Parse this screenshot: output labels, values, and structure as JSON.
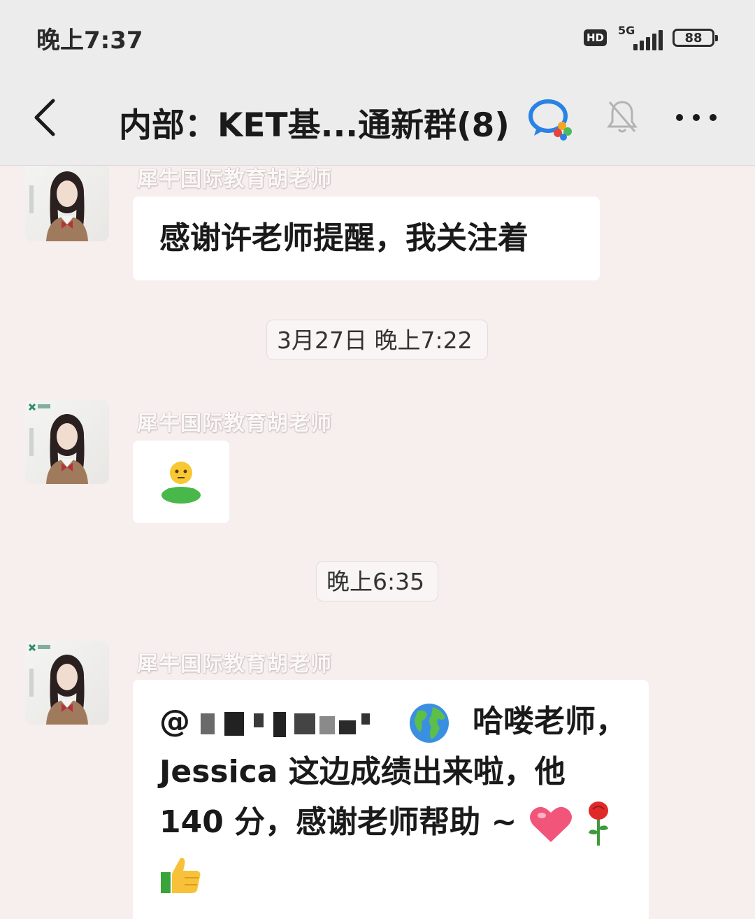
{
  "status_bar": {
    "time": "晚上7:37",
    "hd": "HD",
    "network": "5G",
    "battery": "88"
  },
  "header": {
    "title": "内部：KET基...通新群(8)",
    "icons": [
      "back-icon",
      "wecom-icon",
      "mute-bell-icon",
      "more-icon"
    ]
  },
  "messages": [
    {
      "sender": "犀牛国际教育胡老师",
      "text": "感谢许老师提醒，我关注着"
    },
    {
      "timestamp": "3月27日 晚上7:22"
    },
    {
      "sender": "犀牛国际教育胡老师",
      "emoji": "person-green-shirt"
    },
    {
      "timestamp": "晚上6:35"
    },
    {
      "sender": "犀牛国际教育胡老师",
      "mention": "@",
      "line1": "哈喽老师，",
      "line2": "Jessica 这边成绩出来啦，他",
      "line3": "140 分，感谢老师帮助 ~",
      "emojis": [
        "globe-emoji",
        "heart-emoji",
        "rose-emoji",
        "thumbs-up-emoji"
      ]
    }
  ],
  "colors": {
    "background": "#f7eeee",
    "header": "#ececec",
    "bubble": "#ffffff"
  }
}
